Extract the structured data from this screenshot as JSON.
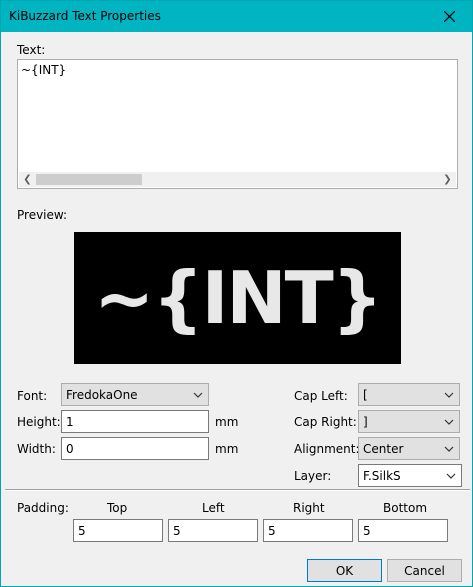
{
  "window": {
    "title": "KiBuzzard Text Properties"
  },
  "text_section": {
    "label": "Text:",
    "value": "~{INT}"
  },
  "preview": {
    "label": "Preview:",
    "rendered_text": "~{INT}"
  },
  "font": {
    "label": "Font:",
    "value": "FredokaOne"
  },
  "height": {
    "label": "Height:",
    "value": "1",
    "unit": "mm"
  },
  "width": {
    "label": "Width:",
    "value": "0",
    "unit": "mm"
  },
  "cap_left": {
    "label": "Cap Left:",
    "value": "["
  },
  "cap_right": {
    "label": "Cap Right:",
    "value": "]"
  },
  "alignment": {
    "label": "Alignment:",
    "value": "Center"
  },
  "layer": {
    "label": "Layer:",
    "value": "F.SilkS"
  },
  "padding": {
    "label": "Padding:",
    "top": {
      "label": "Top",
      "value": "5"
    },
    "left": {
      "label": "Left",
      "value": "5"
    },
    "right": {
      "label": "Right",
      "value": "5"
    },
    "bottom": {
      "label": "Bottom",
      "value": "5"
    }
  },
  "buttons": {
    "ok": "OK",
    "cancel": "Cancel"
  },
  "icons": {
    "close": "close-icon",
    "dropdown": "chevron-down-icon",
    "scroll_left": "arrow-left-icon",
    "scroll_right": "arrow-right-icon"
  },
  "colors": {
    "titlebar": "#00b4c2",
    "preview_bg": "#000000",
    "preview_fg": "#e8e8e8",
    "default_button_border": "#0078d7"
  }
}
